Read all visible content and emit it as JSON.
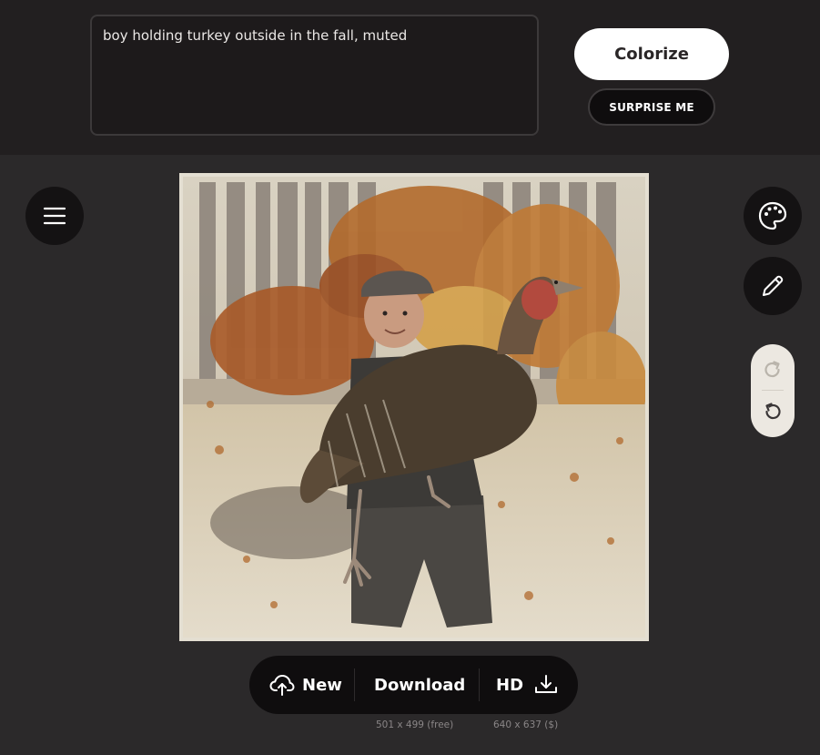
{
  "prompt": {
    "text": "boy holding turkey outside in the fall, muted"
  },
  "buttons": {
    "colorize": "Colorize",
    "surprise": "SURPRISE ME"
  },
  "toolbar": {
    "new_label": "New",
    "download_label": "Download",
    "hd_label": "HD",
    "free_size_note": "501 x 499 (free)",
    "hd_size_note": "640 x 637 ($)"
  },
  "icons": {
    "menu": "menu-icon",
    "palette": "palette-icon",
    "pencil": "pencil-icon",
    "redo": "redo-icon",
    "undo": "undo-icon",
    "upload": "cloud-upload-icon",
    "download": "download-icon"
  },
  "colors": {
    "background": "#2b292a",
    "topbar": "#221f20",
    "button_dark": "#141213",
    "button_light": "#ffffff",
    "undo_panel": "#ece8e1"
  }
}
